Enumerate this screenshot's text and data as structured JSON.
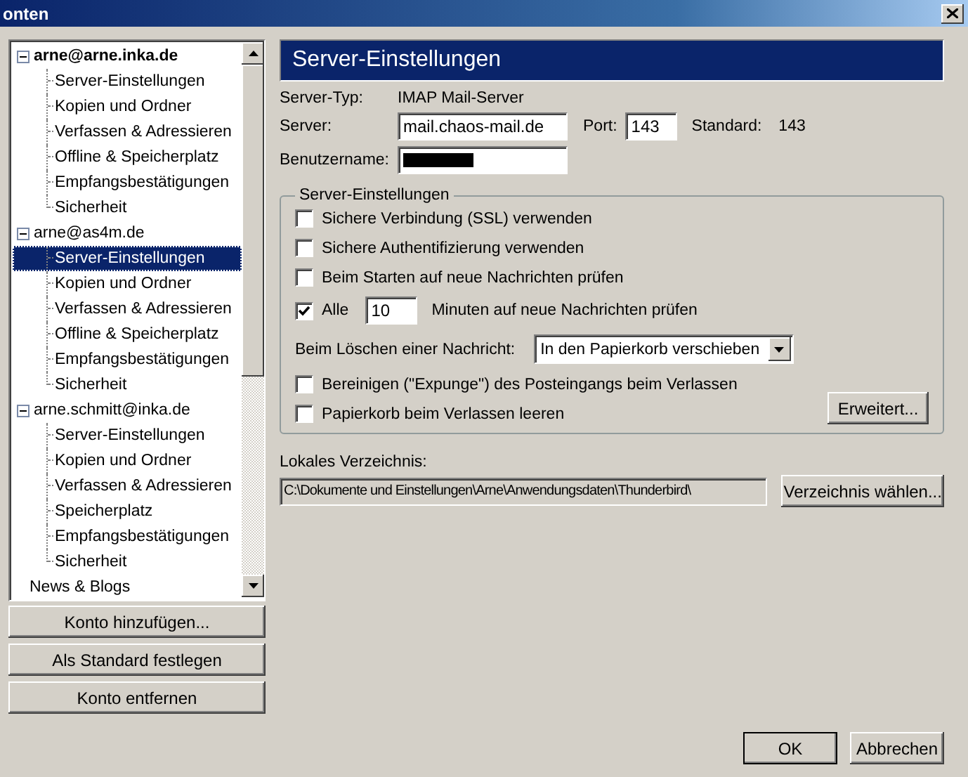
{
  "window": {
    "title": "onten"
  },
  "accounts_tree": {
    "items": [
      {
        "kind": "expandable",
        "label": "arne@arne.inka.de",
        "default": true,
        "expanded": true,
        "selected": false,
        "children": [
          {
            "label": "Server-Einstellungen",
            "selected": false
          },
          {
            "label": "Kopien und Ordner",
            "selected": false
          },
          {
            "label": "Verfassen & Adressieren",
            "selected": false
          },
          {
            "label": "Offline & Speicherplatz",
            "selected": false
          },
          {
            "label": "Empfangsbestätigungen",
            "selected": false
          },
          {
            "label": "Sicherheit",
            "selected": false
          }
        ]
      },
      {
        "kind": "expandable",
        "label": "arne@as4m.de",
        "default": false,
        "expanded": true,
        "selected": false,
        "children": [
          {
            "label": "Server-Einstellungen",
            "selected": true
          },
          {
            "label": "Kopien und Ordner",
            "selected": false
          },
          {
            "label": "Verfassen & Adressieren",
            "selected": false
          },
          {
            "label": "Offline & Speicherplatz",
            "selected": false
          },
          {
            "label": "Empfangsbestätigungen",
            "selected": false
          },
          {
            "label": "Sicherheit",
            "selected": false
          }
        ]
      },
      {
        "kind": "expandable",
        "label": "arne.schmitt@inka.de",
        "default": false,
        "expanded": true,
        "selected": false,
        "children": [
          {
            "label": "Server-Einstellungen",
            "selected": false
          },
          {
            "label": "Kopien und Ordner",
            "selected": false
          },
          {
            "label": "Verfassen & Adressieren",
            "selected": false
          },
          {
            "label": "Speicherplatz",
            "selected": false
          },
          {
            "label": "Empfangsbestätigungen",
            "selected": false
          },
          {
            "label": "Sicherheit",
            "selected": false
          }
        ]
      },
      {
        "kind": "plain",
        "label": "News & Blogs",
        "default": false,
        "selected": false
      }
    ]
  },
  "account_buttons": [
    "Konto hinzufügen...",
    "Als Standard festlegen",
    "Konto entfernen"
  ],
  "panel": {
    "title": "Server-Einstellungen",
    "server_type": {
      "label": "Server-Typ:",
      "value": "IMAP Mail-Server"
    },
    "server": {
      "label": "Server:",
      "value": "mail.chaos-mail.de"
    },
    "port": {
      "label": "Port:",
      "value": "143"
    },
    "standard": {
      "label": "Standard:",
      "value": "143"
    },
    "username": {
      "label": "Benutzername:",
      "redacted": true
    },
    "group": {
      "title": "Server-Einstellungen",
      "options": [
        {
          "kind": "checkbox",
          "label": "Sichere Verbindung (SSL) verwenden",
          "checked": false
        },
        {
          "kind": "checkbox",
          "label": "Sichere Authentifizierung verwenden",
          "checked": false
        },
        {
          "kind": "checkbox",
          "label": "Beim Starten auf neue Nachrichten prüfen",
          "checked": false
        },
        {
          "kind": "interval",
          "label": "Alle",
          "checked": true,
          "value": "10",
          "suffix": "Minuten auf neue Nachrichten prüfen"
        },
        {
          "kind": "select",
          "label": "Beim Löschen einer Nachricht:",
          "value": "In den Papierkorb verschieben"
        },
        {
          "kind": "checkbox",
          "label": "Bereinigen (\"Expunge\") des Posteingangs beim Verlassen",
          "checked": false
        },
        {
          "kind": "checkbox",
          "label": "Papierkorb beim Verlassen leeren",
          "checked": false
        }
      ],
      "advanced_button": "Erweitert..."
    },
    "local_directory": {
      "label": "Lokales Verzeichnis:",
      "value": "C:\\Dokumente und Einstellungen\\Arne\\Anwendungsdaten\\Thunderbird\\",
      "button": "Verzeichnis wählen..."
    }
  },
  "dialog_buttons": [
    "OK",
    "Abbrechen"
  ]
}
